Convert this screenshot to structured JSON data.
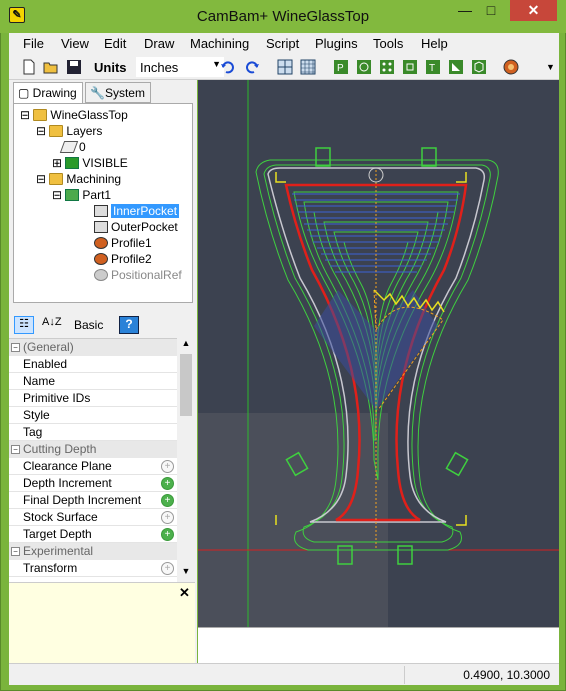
{
  "window": {
    "title": "CamBam+  WineGlassTop"
  },
  "menu": [
    "File",
    "View",
    "Edit",
    "Draw",
    "Machining",
    "Script",
    "Plugins",
    "Tools",
    "Help"
  ],
  "toolbar": {
    "units_label": "Units",
    "units_value": "Inches"
  },
  "tabs": {
    "drawing": "Drawing",
    "system": "System"
  },
  "tree": {
    "root": "WineGlassTop",
    "layers": "Layers",
    "layer0": "0",
    "layer_visible": "VISIBLE",
    "machining": "Machining",
    "part": "Part1",
    "ops": [
      "InnerPocket",
      "OuterPocket",
      "Profile1",
      "Profile2",
      "PositionalRef"
    ]
  },
  "props": {
    "basic_label": "Basic",
    "cat_general": "(General)",
    "general": [
      "Enabled",
      "Name",
      "Primitive IDs",
      "Style",
      "Tag"
    ],
    "cat_cutting": "Cutting Depth",
    "cutting": [
      "Clearance Plane",
      "Depth Increment",
      "Final Depth Increment",
      "Stock Surface",
      "Target Depth"
    ],
    "cat_experimental": "Experimental",
    "experimental": [
      "Transform"
    ]
  },
  "status": {
    "coords": "0.4900, 10.3000"
  },
  "colors": {
    "titlebar": "#82b93e",
    "canvas_bg": "#3c4250",
    "selection": "#3399ff",
    "toolpath_green": "#3fcf3f",
    "toolpath_blue": "#3b63d6",
    "profile_red": "#e0201a"
  }
}
